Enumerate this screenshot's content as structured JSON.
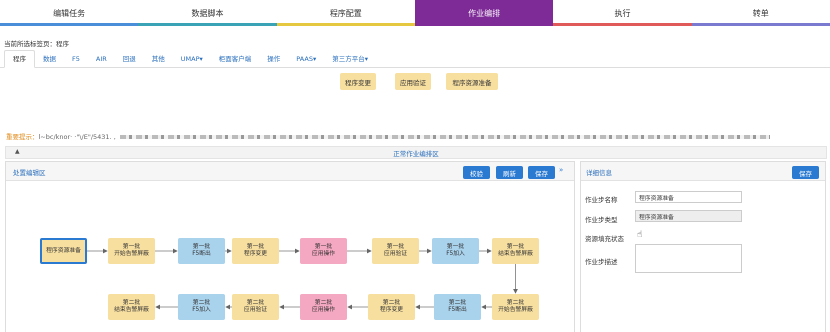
{
  "topnav": [
    {
      "label": "编辑任务",
      "color": "#4a8ed9"
    },
    {
      "label": "数据脚本",
      "color": "#3aa3b5"
    },
    {
      "label": "程序配置",
      "color": "#e6c840"
    },
    {
      "label": "作业编排",
      "color": "#7e2a97"
    },
    {
      "label": "执行",
      "color": "#e05a5a"
    },
    {
      "label": "转单",
      "color": "#7a7ad0"
    }
  ],
  "breadcrumb": "当前所选标签页：程序",
  "subtabs": [
    "程序",
    "数据",
    "F5",
    "AIR",
    "回退",
    "其他",
    "UMAP▾",
    "柜面客户端",
    "操作",
    "PAAS▾",
    "第三方平台▾"
  ],
  "tags": [
    "程序变更",
    "应用验证",
    "程序资源准备"
  ],
  "notice": {
    "label": "重要提示：",
    "text": "l~bc/knor·  ·\"\\/E\"/5431. ,"
  },
  "section_title": "正常作业编排区",
  "left": {
    "title": "处置编辑区",
    "btn_check": "校验",
    "btn_refresh": "刷新",
    "btn_save": "保存",
    "expand_icon": "»"
  },
  "flow_row1": [
    {
      "l1": "程序资源准备",
      "l2": "",
      "kind": "y"
    },
    {
      "l1": "第一批",
      "l2": "开始告警屏蔽",
      "kind": "y"
    },
    {
      "l1": "第一批",
      "l2": "F5断出",
      "kind": "b"
    },
    {
      "l1": "第一批",
      "l2": "程序变更",
      "kind": "y"
    },
    {
      "l1": "第一批",
      "l2": "应用操作",
      "kind": "p"
    },
    {
      "l1": "第一批",
      "l2": "应用验证",
      "kind": "y"
    },
    {
      "l1": "第一批",
      "l2": "F5加入",
      "kind": "b"
    },
    {
      "l1": "第一批",
      "l2": "结束告警屏蔽",
      "kind": "y"
    }
  ],
  "flow_row2": [
    {
      "l1": "第二批",
      "l2": "结束告警屏蔽",
      "kind": "y"
    },
    {
      "l1": "第二批",
      "l2": "F5加入",
      "kind": "b"
    },
    {
      "l1": "第二批",
      "l2": "应用验证",
      "kind": "y"
    },
    {
      "l1": "第二批",
      "l2": "应用操作",
      "kind": "p"
    },
    {
      "l1": "第二批",
      "l2": "程序变更",
      "kind": "y"
    },
    {
      "l1": "第二批",
      "l2": "F5断出",
      "kind": "b"
    },
    {
      "l1": "第二批",
      "l2": "开始告警屏蔽",
      "kind": "y"
    }
  ],
  "right": {
    "title": "详细信息",
    "btn_save": "保存",
    "name_label": "作业步名称",
    "name_value": "程序资源准备",
    "type_label": "作业步类型",
    "type_value": "程序资源准备",
    "fill_label": "资源填充状态",
    "fill_icon": "hand-pointer-icon",
    "desc_label": "作业步描述",
    "desc_value": ""
  }
}
